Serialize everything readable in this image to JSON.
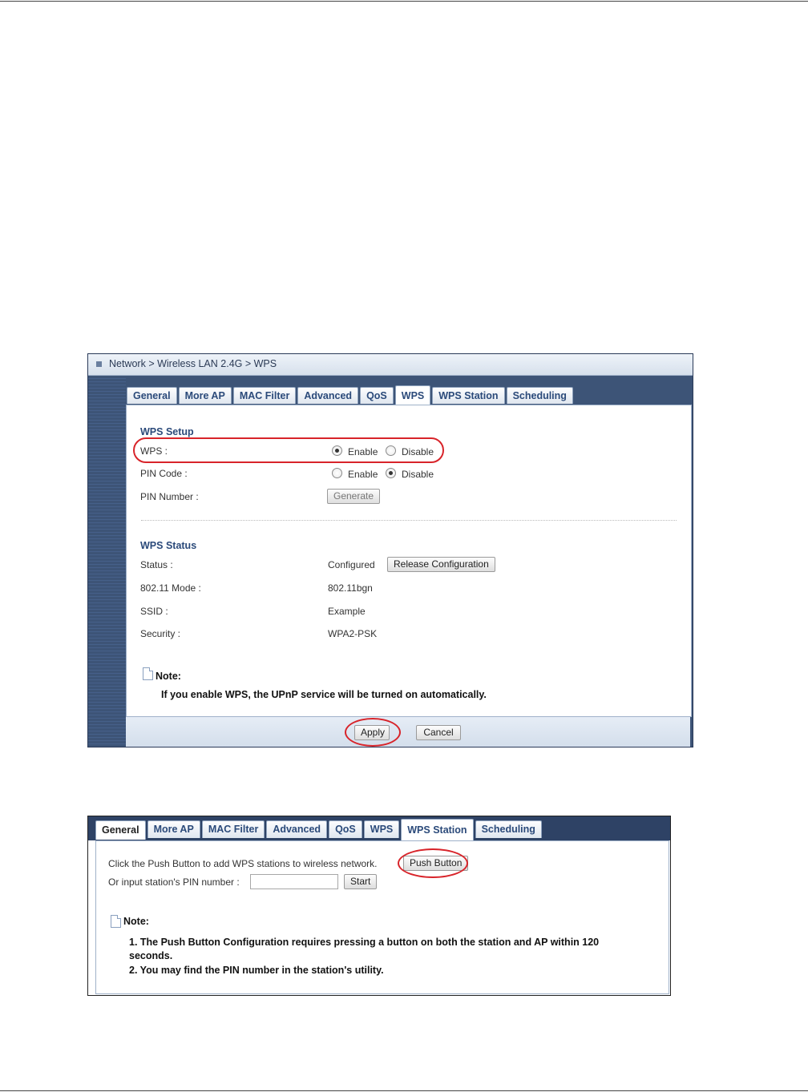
{
  "figure1": {
    "breadcrumb": "Network > Wireless LAN 2.4G > WPS",
    "tabs": [
      "General",
      "More AP",
      "MAC Filter",
      "Advanced",
      "QoS",
      "WPS",
      "WPS Station",
      "Scheduling"
    ],
    "active_tab": "WPS",
    "wps_setup": {
      "title": "WPS Setup",
      "wps_label": "WPS :",
      "wps_value": "Enable",
      "pin_code_label": "PIN Code :",
      "pin_code_value": "Disable",
      "pin_number_label": "PIN Number :",
      "enable_label": "Enable",
      "disable_label": "Disable",
      "generate_button": "Generate"
    },
    "wps_status": {
      "title": "WPS Status",
      "status_label": "Status :",
      "status_value": "Configured",
      "release_button": "Release Configuration",
      "mode_label": "802.11 Mode :",
      "mode_value": "802.11bgn",
      "ssid_label": "SSID :",
      "ssid_value": "Example",
      "security_label": "Security :",
      "security_value": "WPA2-PSK"
    },
    "note": {
      "label": "Note:",
      "text": "If you enable WPS, the UPnP service will be turned on automatically."
    },
    "footer": {
      "apply_button": "Apply",
      "cancel_button": "Cancel"
    },
    "highlight_color": "#d8242a"
  },
  "figure2": {
    "tabs": [
      "General",
      "More AP",
      "MAC Filter",
      "Advanced",
      "QoS",
      "WPS",
      "WPS Station",
      "Scheduling"
    ],
    "active_tab": "WPS Station",
    "push_text": "Click the Push Button to add WPS stations to wireless network.",
    "push_button": "Push Button",
    "pin_text": "Or input station's PIN number :",
    "pin_value": "",
    "start_button": "Start",
    "note": {
      "label": "Note:",
      "line1": "1. The Push Button Configuration requires pressing a button on both the station and AP within 120",
      "line1b": "seconds.",
      "line2": "2. You may find the PIN number in the station's utility."
    }
  }
}
